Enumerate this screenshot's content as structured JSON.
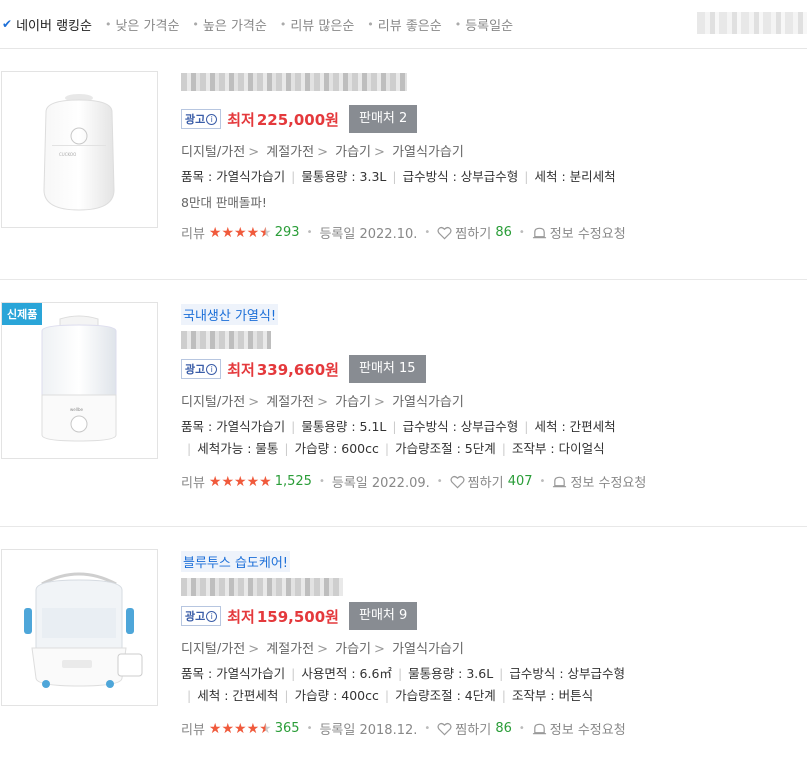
{
  "sort": {
    "items": [
      {
        "label": "네이버 랭킹순",
        "active": true
      },
      {
        "label": "낮은 가격순",
        "active": false
      },
      {
        "label": "높은 가격순",
        "active": false
      },
      {
        "label": "리뷰 많은순",
        "active": false
      },
      {
        "label": "리뷰 좋은순",
        "active": false
      },
      {
        "label": "등록일순",
        "active": false
      }
    ]
  },
  "colors": {
    "price": "#e4393c",
    "link": "#1c6fd8",
    "review_count": "#2a9d38",
    "star": "#f05a3c",
    "seller_bg": "#888c92"
  },
  "products": [
    {
      "promo": "",
      "ad_label": "광고",
      "price_label": "최저",
      "price": "225,000원",
      "seller": "판매처 2",
      "category": [
        "디지털/가전",
        "계절가전",
        "가습기",
        "가열식가습기"
      ],
      "specs_line1": [
        "품목 : 가열식가습기",
        "물통용량 : 3.3L",
        "급수방식 : 상부급수형",
        "세척 : 분리세척"
      ],
      "specs_line2": [],
      "highlight": "8만대 판매돌파!",
      "review_label": "리뷰",
      "review_count": "293",
      "rating_stars": 4.5,
      "registered": "등록일 2022.10.",
      "wish_label": "찜하기",
      "wish_count": "86",
      "report": "정보 수정요청",
      "new_badge": ""
    },
    {
      "promo": "국내생산 가열식!",
      "ad_label": "광고",
      "price_label": "최저",
      "price": "339,660원",
      "seller": "판매처 15",
      "category": [
        "디지털/가전",
        "계절가전",
        "가습기",
        "가열식가습기"
      ],
      "specs_line1": [
        "품목 : 가열식가습기",
        "물통용량 : 5.1L",
        "급수방식 : 상부급수형",
        "세척 : 간편세척"
      ],
      "specs_line2": [
        "세척가능 : 물통",
        "가습량 : 600cc",
        "가습량조절 : 5단계",
        "조작부 : 다이얼식"
      ],
      "highlight": "",
      "review_label": "리뷰",
      "review_count": "1,525",
      "rating_stars": 5,
      "registered": "등록일 2022.09.",
      "wish_label": "찜하기",
      "wish_count": "407",
      "report": "정보 수정요청",
      "new_badge": "신제품"
    },
    {
      "promo": "블루투스 습도케어!",
      "ad_label": "광고",
      "price_label": "최저",
      "price": "159,500원",
      "seller": "판매처 9",
      "category": [
        "디지털/가전",
        "계절가전",
        "가습기",
        "가열식가습기"
      ],
      "specs_line1": [
        "품목 : 가열식가습기",
        "사용면적 : 6.6㎡",
        "물통용량 : 3.6L",
        "급수방식 : 상부급수형"
      ],
      "specs_line2": [
        "세척 : 간편세척",
        "가습량 : 400cc",
        "가습량조절 : 4단계",
        "조작부 : 버튼식"
      ],
      "highlight": "",
      "review_label": "리뷰",
      "review_count": "365",
      "rating_stars": 4.5,
      "registered": "등록일 2018.12.",
      "wish_label": "찜하기",
      "wish_count": "86",
      "report": "정보 수정요청",
      "new_badge": ""
    }
  ]
}
